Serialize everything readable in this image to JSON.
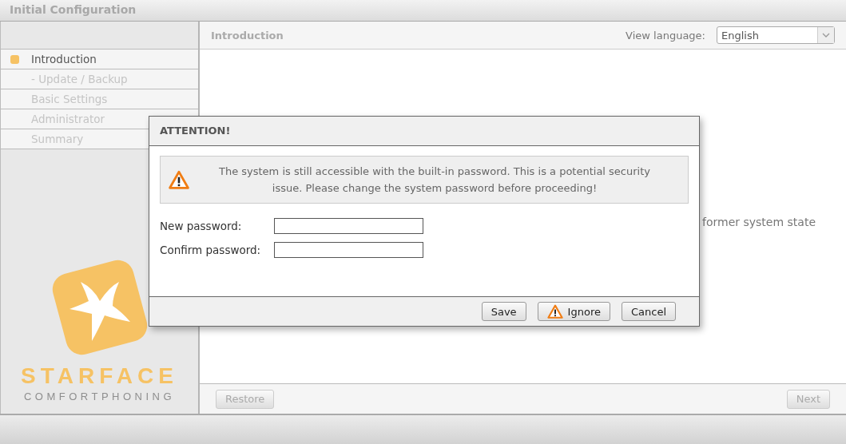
{
  "window": {
    "title": "Initial Configuration"
  },
  "sidebar": {
    "items": [
      {
        "label": "Introduction",
        "selected": true
      },
      {
        "label": "- Update / Backup",
        "selected": false
      },
      {
        "label": "Basic Settings",
        "selected": false
      },
      {
        "label": "Administrator",
        "selected": false
      },
      {
        "label": "Summary",
        "selected": false
      }
    ],
    "logo": {
      "name": "STARFACE",
      "tagline": "COMFORTPHONING"
    }
  },
  "content": {
    "title": "Introduction",
    "language_label": "View language:",
    "language": "English",
    "body_text": "former system state",
    "buttons": [
      {
        "label": "Restore",
        "disabled": true
      },
      {
        "label": "Next",
        "disabled": true
      }
    ]
  },
  "dialog": {
    "title": "ATTENTION!",
    "message": "The system is still accessible with the built-in password. This is a potential security issue. Please change the system password before proceeding!",
    "fields": [
      {
        "label": "New password:"
      },
      {
        "label": "Confirm password:"
      }
    ],
    "buttons": [
      {
        "label": "Save",
        "kind": "plain"
      },
      {
        "label": "Ignore",
        "kind": "warning"
      },
      {
        "label": "Cancel",
        "kind": "plain"
      }
    ]
  }
}
